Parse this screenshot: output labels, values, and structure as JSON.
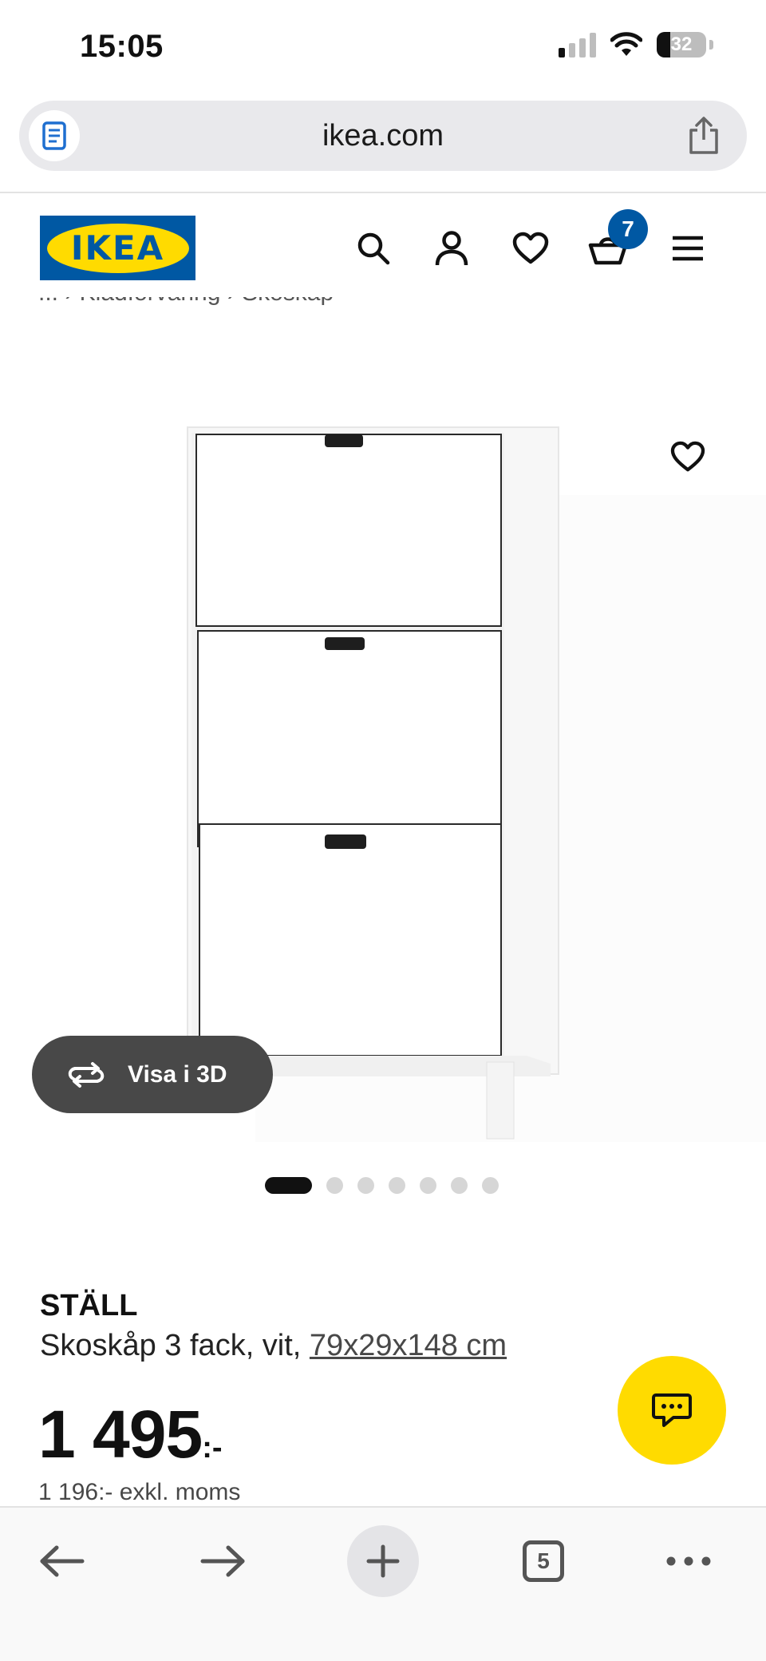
{
  "status_bar": {
    "time": "15:05",
    "battery": "32"
  },
  "browser": {
    "url": "ikea.com",
    "tab_count": "5"
  },
  "site": {
    "logo_text": "IKEA",
    "cart_count": "7",
    "breadcrumb": [
      "...",
      "Klädförvaring",
      "Skoskåp"
    ],
    "breadcrumb_display": "... › Klädförvaring › Skoskåp"
  },
  "product": {
    "view_3d_label": "Visa i 3D",
    "gallery": {
      "total": 7,
      "active_index": 0
    },
    "name": "STÄLL",
    "description_prefix": "Skoskåp 3 fack, vit, ",
    "dimensions": "79x29x148 cm",
    "price_main": "1 495",
    "price_suffix": ":-",
    "price_excl_vat": "1 196:- exkl. moms"
  },
  "colors": {
    "ikea_blue": "#0058a3",
    "ikea_yellow": "#ffdb00",
    "button_dark": "#484848"
  },
  "icons": [
    "reader-icon",
    "share-icon",
    "search-icon",
    "user-icon",
    "heart-icon",
    "cart-icon",
    "menu-icon",
    "rotate-icon",
    "chat-icon",
    "back-arrow-icon",
    "forward-arrow-icon",
    "plus-icon",
    "more-icon"
  ]
}
